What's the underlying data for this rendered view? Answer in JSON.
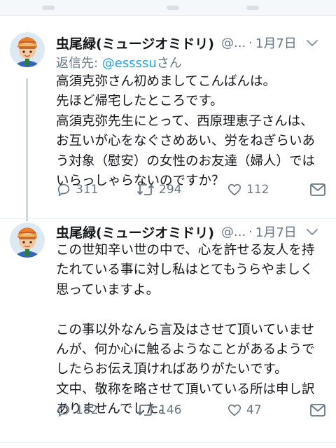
{
  "tweets": [
    {
      "name": "虫尾緑(ミュージオミドリ)",
      "handle": "@...",
      "separator": "·",
      "date": "1月7日",
      "reply_to": {
        "prefix": "返信先: ",
        "mention": "@essssu",
        "suffix": "さん"
      },
      "lines": [
        "高須克弥さん初めましてこんばんは。",
        "先ほど帰宅したところです。",
        "高須克弥先生にとって、西原理恵子さんは、",
        "お互いが心をなぐさめあい、労をねぎらいあ",
        "う対象（慰安）の女性のお友達（婦人）では",
        "いらっしゃらないのですか？"
      ],
      "replies": "311",
      "retweets": "294",
      "likes": "112"
    },
    {
      "name": "虫尾緑(ミュージオミドリ)",
      "handle": "@...",
      "separator": "·",
      "date": "1月7日",
      "lines": [
        "この世知辛い世の中で、心を許せる友人を持",
        "たれている事に対し私はとてもうらやましく",
        "思っていますよ。",
        "",
        "この事以外なんら言及はさせて頂いていませ",
        "んが、何か心に触るようなことがあるようで",
        "したらお伝え頂ければありがたいです。",
        "文中、敬称を略させて頂いている所は申し訳",
        "ありませんでした。"
      ],
      "replies": "182",
      "retweets": "146",
      "likes": "47"
    }
  ],
  "colors": {
    "text": "#14171a",
    "secondary": "#657786",
    "link": "#1da1f2",
    "divider": "#e6ecf0",
    "thread_line": "#ccd6dd"
  },
  "icons": {
    "reply": "reply-icon",
    "retweet": "retweet-icon",
    "like": "heart-icon",
    "dm": "mail-icon",
    "menu": "chevron-down-icon"
  }
}
